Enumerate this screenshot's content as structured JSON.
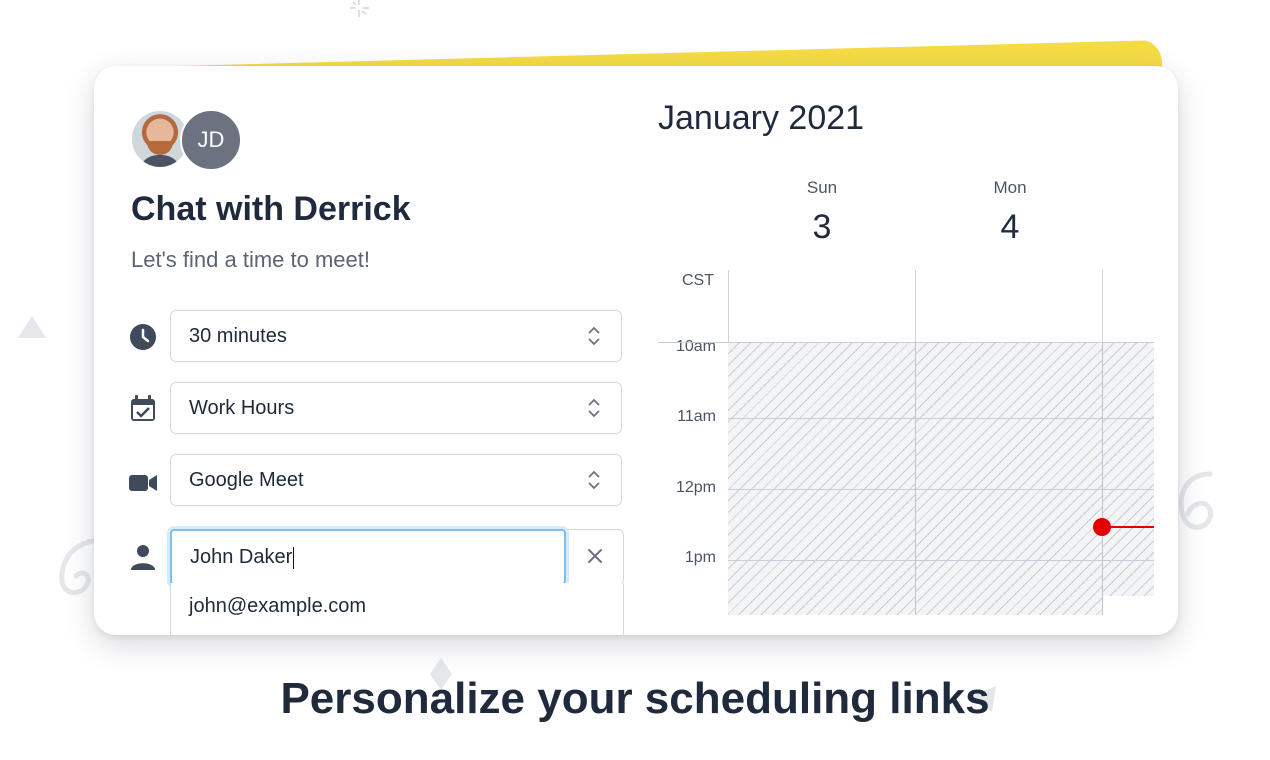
{
  "app": {
    "avatar_initials": "JD",
    "title": "Chat with Derrick",
    "subtitle": "Let's find a time to meet!"
  },
  "form": {
    "duration": {
      "value": "30 minutes",
      "icon": "clock-icon"
    },
    "schedule": {
      "value": "Work Hours",
      "icon": "calendar-check-icon"
    },
    "location": {
      "value": "Google Meet",
      "icon": "video-camera-icon"
    },
    "guest_name": {
      "value": "John Daker",
      "icon": "person-icon"
    },
    "guest_email_suggestion": "john@example.com"
  },
  "calendar": {
    "month_label": "January 2021",
    "timezone": "CST",
    "days": [
      {
        "name": "Sun",
        "number": "3"
      },
      {
        "name": "Mon",
        "number": "4"
      }
    ],
    "hours": [
      "10am",
      "11am",
      "12pm",
      "1pm"
    ],
    "current_time_indicator_color": "#e40000"
  },
  "tagline": "Personalize your scheduling links",
  "colors": {
    "accent_yellow": "#f5dc45",
    "focus_blue": "#7cc0ef",
    "text_dark": "#1f2a3c"
  }
}
